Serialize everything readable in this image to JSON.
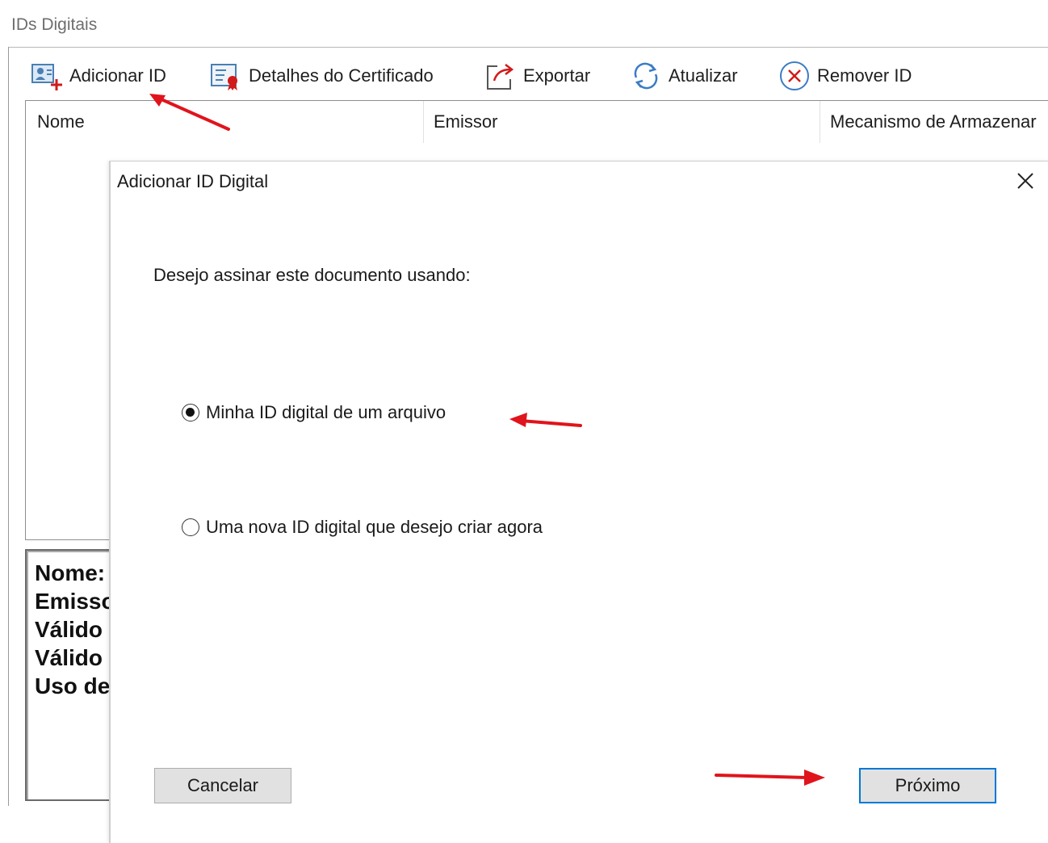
{
  "window": {
    "title": "IDs Digitais"
  },
  "toolbar": {
    "add_id": "Adicionar ID",
    "certificate_details": "Detalhes do Certificado",
    "export": "Exportar",
    "refresh": "Atualizar",
    "remove_id": "Remover ID"
  },
  "list": {
    "columns": [
      "Nome",
      "Emissor",
      "Mecanismo de Armazenar"
    ]
  },
  "details": {
    "lines": [
      "Nome:",
      "Emissor",
      "Válido",
      "Válido",
      "Uso de"
    ]
  },
  "dialog": {
    "title": "Adicionar ID Digital",
    "prompt": "Desejo assinar este documento usando:",
    "options": [
      {
        "label": "Minha ID digital de um arquivo",
        "selected": true
      },
      {
        "label": "Uma nova ID digital que desejo criar agora",
        "selected": false
      }
    ],
    "cancel_label": "Cancelar",
    "next_label": "Próximo"
  },
  "colors": {
    "annotation_arrow": "#e0141c",
    "focus_border": "#0078d7",
    "button_face": "#e1e1e1"
  }
}
